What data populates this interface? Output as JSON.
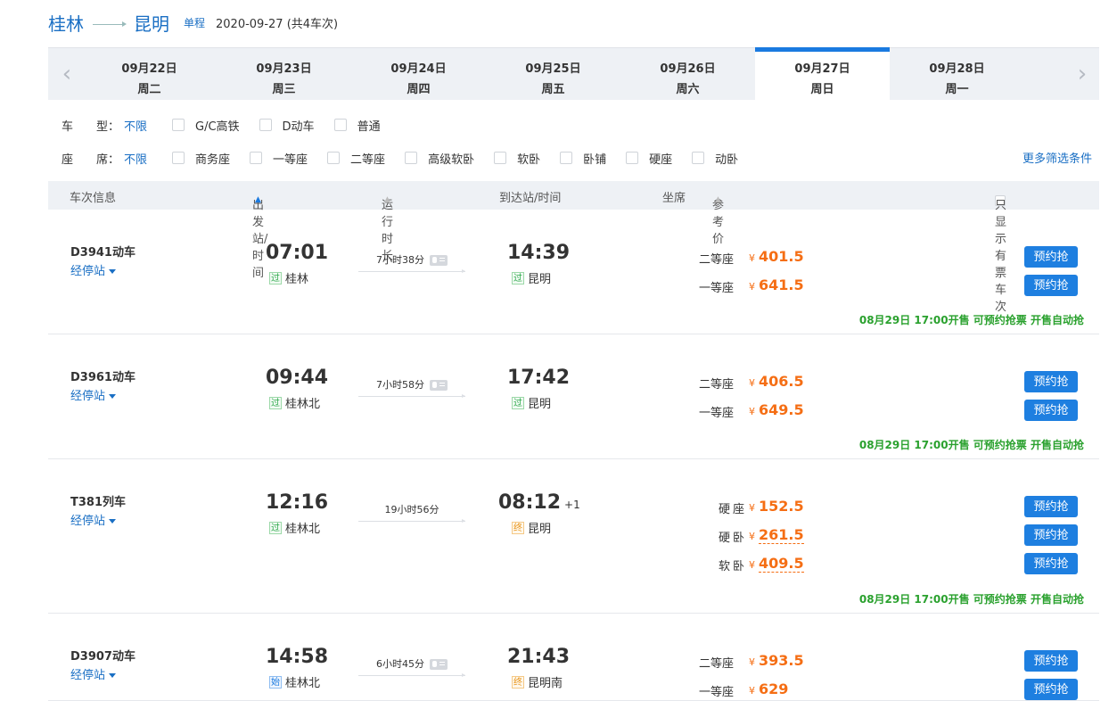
{
  "route": {
    "from": "桂林",
    "to": "昆明",
    "trip_type": "单程",
    "info": "2020-09-27 (共4车次)"
  },
  "dates": [
    {
      "date": "09月22日",
      "weekday": "周二"
    },
    {
      "date": "09月23日",
      "weekday": "周三"
    },
    {
      "date": "09月24日",
      "weekday": "周四"
    },
    {
      "date": "09月25日",
      "weekday": "周五"
    },
    {
      "date": "09月26日",
      "weekday": "周六"
    },
    {
      "date": "09月27日",
      "weekday": "周日",
      "active": true
    },
    {
      "date": "09月28日",
      "weekday": "周一"
    }
  ],
  "icons": {
    "prev": "chevron-left-icon",
    "next": "chevron-right-icon"
  },
  "filters": {
    "type_label": "车　　型：",
    "seat_label": "座　　席：",
    "unlimited": "不限",
    "train_types": [
      "G/C高铁",
      "D动车",
      "普通"
    ],
    "seat_types": [
      "商务座",
      "一等座",
      "二等座",
      "高级软卧",
      "软卧",
      "卧铺",
      "硬座",
      "动卧"
    ],
    "more": "更多筛选条件"
  },
  "table_header": {
    "train_info": "车次信息",
    "depart": "出发站/时间",
    "duration": "运行时长",
    "arrive": "到达站/时间",
    "seat": "坐席",
    "price": "参考价",
    "only_available": "只显示有票车次"
  },
  "trains": [
    {
      "no": "D3941动车",
      "stops": "经停站",
      "dep_time": "07:01",
      "dep_tag": "过",
      "dep_station": "桂林",
      "duration": "7小时38分",
      "arr_time": "14:39",
      "arr_plus": "",
      "arr_tag": "过",
      "arr_station": "昆明",
      "seats": [
        {
          "name": "二等座",
          "price": "401.5"
        },
        {
          "name": "一等座",
          "price": "641.5"
        }
      ],
      "note": "08月29日 17:00开售 可预约抢票 开售自动抢"
    },
    {
      "no": "D3961动车",
      "stops": "经停站",
      "dep_time": "09:44",
      "dep_tag": "过",
      "dep_station": "桂林北",
      "duration": "7小时58分",
      "arr_time": "17:42",
      "arr_plus": "",
      "arr_tag": "过",
      "arr_station": "昆明",
      "seats": [
        {
          "name": "二等座",
          "price": "406.5"
        },
        {
          "name": "一等座",
          "price": "649.5"
        }
      ],
      "note": "08月29日 17:00开售 可预约抢票 开售自动抢"
    },
    {
      "no": "T381列车",
      "stops": "经停站",
      "dep_time": "12:16",
      "dep_tag": "过",
      "dep_station": "桂林北",
      "duration": "19小时56分",
      "arr_time": "08:12",
      "arr_plus": "+1",
      "arr_tag": "终",
      "arr_station": "昆明",
      "seats": [
        {
          "name": "硬座",
          "price": "152.5"
        },
        {
          "name": "硬卧",
          "price": "261.5"
        },
        {
          "name": "软卧",
          "price": "409.5"
        }
      ],
      "note": "08月29日 17:00开售 可预约抢票 开售自动抢"
    },
    {
      "no": "D3907动车",
      "stops": "经停站",
      "dep_time": "14:58",
      "dep_tag": "始",
      "dep_station": "桂林北",
      "duration": "6小时45分",
      "arr_time": "21:43",
      "arr_plus": "",
      "arr_tag": "终",
      "arr_station": "昆明南",
      "seats": [
        {
          "name": "二等座",
          "price": "393.5"
        },
        {
          "name": "一等座",
          "price": "629"
        }
      ],
      "note": ""
    }
  ],
  "yen": "¥",
  "book_label": "预约抢"
}
